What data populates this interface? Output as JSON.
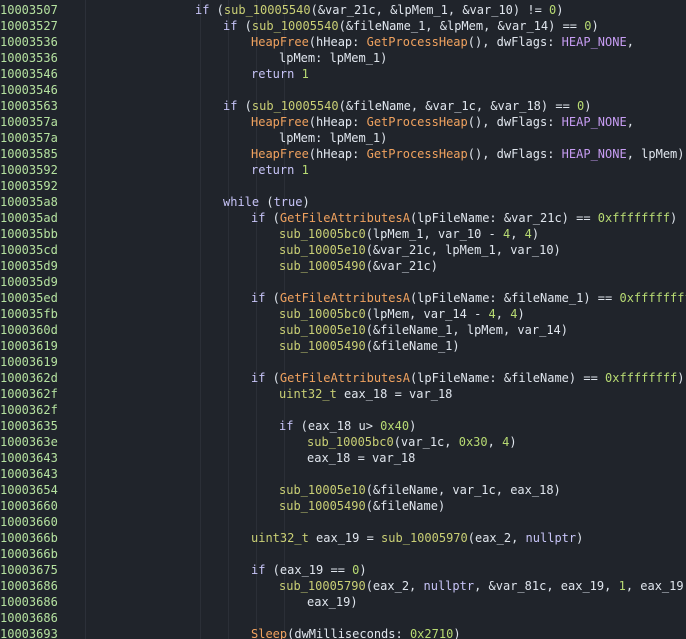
{
  "colors": {
    "background": "#20242b",
    "address": "#b5e2a0",
    "keyword": "#c7c4f7",
    "import_function": "#f0a25f",
    "symbol": "#c9cf75",
    "number": "#b8db73",
    "constant": "#c69cf2",
    "text": "#d6dde6"
  },
  "lines": [
    {
      "addr": "10003507",
      "indent": 0,
      "tokens": [
        [
          "k",
          "if"
        ],
        [
          "t",
          " ("
        ],
        [
          "s",
          "sub_10005540"
        ],
        [
          "t",
          "(&var_21c, &lpMem_1, &var_10) != "
        ],
        [
          "n",
          "0"
        ],
        [
          "t",
          ")"
        ]
      ]
    },
    {
      "addr": "10003527",
      "indent": 1,
      "tokens": [
        [
          "k",
          "if"
        ],
        [
          "t",
          " ("
        ],
        [
          "s",
          "sub_10005540"
        ],
        [
          "t",
          "(&fileName_1, &lpMem, &var_14) == "
        ],
        [
          "n",
          "0"
        ],
        [
          "t",
          ")"
        ]
      ]
    },
    {
      "addr": "10003536",
      "indent": 2,
      "tokens": [
        [
          "f",
          "HeapFree"
        ],
        [
          "t",
          "(hHeap: "
        ],
        [
          "f",
          "GetProcessHeap"
        ],
        [
          "t",
          "(), dwFlags: "
        ],
        [
          "c",
          "HEAP_NONE"
        ],
        [
          "t",
          ","
        ]
      ]
    },
    {
      "addr": "10003536",
      "indent": 3,
      "tokens": [
        [
          "t",
          "lpMem: lpMem_1)"
        ]
      ]
    },
    {
      "addr": "10003546",
      "indent": 2,
      "tokens": [
        [
          "k",
          "return"
        ],
        [
          "t",
          " "
        ],
        [
          "n",
          "1"
        ]
      ]
    },
    {
      "addr": "10003546",
      "indent": 0,
      "tokens": []
    },
    {
      "addr": "10003563",
      "indent": 1,
      "tokens": [
        [
          "k",
          "if"
        ],
        [
          "t",
          " ("
        ],
        [
          "s",
          "sub_10005540"
        ],
        [
          "t",
          "(&fileName, &var_1c, &var_18) == "
        ],
        [
          "n",
          "0"
        ],
        [
          "t",
          ")"
        ]
      ]
    },
    {
      "addr": "1000357a",
      "indent": 2,
      "tokens": [
        [
          "f",
          "HeapFree"
        ],
        [
          "t",
          "(hHeap: "
        ],
        [
          "f",
          "GetProcessHeap"
        ],
        [
          "t",
          "(), dwFlags: "
        ],
        [
          "c",
          "HEAP_NONE"
        ],
        [
          "t",
          ","
        ]
      ]
    },
    {
      "addr": "1000357a",
      "indent": 3,
      "tokens": [
        [
          "t",
          "lpMem: lpMem_1)"
        ]
      ]
    },
    {
      "addr": "10003585",
      "indent": 2,
      "tokens": [
        [
          "f",
          "HeapFree"
        ],
        [
          "t",
          "(hHeap: "
        ],
        [
          "f",
          "GetProcessHeap"
        ],
        [
          "t",
          "(), dwFlags: "
        ],
        [
          "c",
          "HEAP_NONE"
        ],
        [
          "t",
          ", lpMem)"
        ]
      ]
    },
    {
      "addr": "10003592",
      "indent": 2,
      "tokens": [
        [
          "k",
          "return"
        ],
        [
          "t",
          " "
        ],
        [
          "n",
          "1"
        ]
      ]
    },
    {
      "addr": "10003592",
      "indent": 0,
      "tokens": []
    },
    {
      "addr": "100035a8",
      "indent": 1,
      "tokens": [
        [
          "k",
          "while"
        ],
        [
          "t",
          " ("
        ],
        [
          "k",
          "true"
        ],
        [
          "t",
          ")"
        ]
      ]
    },
    {
      "addr": "100035ad",
      "indent": 2,
      "tokens": [
        [
          "k",
          "if"
        ],
        [
          "t",
          " ("
        ],
        [
          "f",
          "GetFileAttributesA"
        ],
        [
          "t",
          "(lpFileName: &var_21c) == "
        ],
        [
          "n",
          "0xffffffff"
        ],
        [
          "t",
          ")"
        ]
      ]
    },
    {
      "addr": "100035bb",
      "indent": 3,
      "tokens": [
        [
          "s",
          "sub_10005bc0"
        ],
        [
          "t",
          "(lpMem_1, var_10 - "
        ],
        [
          "n",
          "4"
        ],
        [
          "t",
          ", "
        ],
        [
          "n",
          "4"
        ],
        [
          "t",
          ")"
        ]
      ]
    },
    {
      "addr": "100035cd",
      "indent": 3,
      "tokens": [
        [
          "s",
          "sub_10005e10"
        ],
        [
          "t",
          "(&var_21c, lpMem_1, var_10)"
        ]
      ]
    },
    {
      "addr": "100035d9",
      "indent": 3,
      "tokens": [
        [
          "s",
          "sub_10005490"
        ],
        [
          "t",
          "(&var_21c)"
        ]
      ]
    },
    {
      "addr": "100035d9",
      "indent": 0,
      "tokens": []
    },
    {
      "addr": "100035ed",
      "indent": 2,
      "tokens": [
        [
          "k",
          "if"
        ],
        [
          "t",
          " ("
        ],
        [
          "f",
          "GetFileAttributesA"
        ],
        [
          "t",
          "(lpFileName: &fileName_1) == "
        ],
        [
          "n",
          "0xffffffff"
        ],
        [
          "t",
          ")"
        ]
      ]
    },
    {
      "addr": "100035fb",
      "indent": 3,
      "tokens": [
        [
          "s",
          "sub_10005bc0"
        ],
        [
          "t",
          "(lpMem, var_14 - "
        ],
        [
          "n",
          "4"
        ],
        [
          "t",
          ", "
        ],
        [
          "n",
          "4"
        ],
        [
          "t",
          ")"
        ]
      ]
    },
    {
      "addr": "1000360d",
      "indent": 3,
      "tokens": [
        [
          "s",
          "sub_10005e10"
        ],
        [
          "t",
          "(&fileName_1, lpMem, var_14)"
        ]
      ]
    },
    {
      "addr": "10003619",
      "indent": 3,
      "tokens": [
        [
          "s",
          "sub_10005490"
        ],
        [
          "t",
          "(&fileName_1)"
        ]
      ]
    },
    {
      "addr": "10003619",
      "indent": 0,
      "tokens": []
    },
    {
      "addr": "1000362d",
      "indent": 2,
      "tokens": [
        [
          "k",
          "if"
        ],
        [
          "t",
          " ("
        ],
        [
          "f",
          "GetFileAttributesA"
        ],
        [
          "t",
          "(lpFileName: &fileName) == "
        ],
        [
          "n",
          "0xffffffff"
        ],
        [
          "t",
          ")"
        ]
      ]
    },
    {
      "addr": "1000362f",
      "indent": 3,
      "tokens": [
        [
          "s",
          "uint32_t"
        ],
        [
          "t",
          " eax_18 = var_18"
        ]
      ]
    },
    {
      "addr": "1000362f",
      "indent": 0,
      "tokens": []
    },
    {
      "addr": "10003635",
      "indent": 3,
      "tokens": [
        [
          "k",
          "if"
        ],
        [
          "t",
          " (eax_18 u> "
        ],
        [
          "n",
          "0x40"
        ],
        [
          "t",
          ")"
        ]
      ]
    },
    {
      "addr": "1000363e",
      "indent": 4,
      "tokens": [
        [
          "s",
          "sub_10005bc0"
        ],
        [
          "t",
          "(var_1c, "
        ],
        [
          "n",
          "0x30"
        ],
        [
          "t",
          ", "
        ],
        [
          "n",
          "4"
        ],
        [
          "t",
          ")"
        ]
      ]
    },
    {
      "addr": "10003643",
      "indent": 4,
      "tokens": [
        [
          "t",
          "eax_18 = var_18"
        ]
      ]
    },
    {
      "addr": "10003643",
      "indent": 0,
      "tokens": []
    },
    {
      "addr": "10003654",
      "indent": 3,
      "tokens": [
        [
          "s",
          "sub_10005e10"
        ],
        [
          "t",
          "(&fileName, var_1c, eax_18)"
        ]
      ]
    },
    {
      "addr": "10003660",
      "indent": 3,
      "tokens": [
        [
          "s",
          "sub_10005490"
        ],
        [
          "t",
          "(&fileName)"
        ]
      ]
    },
    {
      "addr": "10003660",
      "indent": 0,
      "tokens": []
    },
    {
      "addr": "1000366b",
      "indent": 2,
      "tokens": [
        [
          "s",
          "uint32_t"
        ],
        [
          "t",
          " eax_19 = "
        ],
        [
          "s",
          "sub_10005970"
        ],
        [
          "t",
          "(eax_2, "
        ],
        [
          "k",
          "nullptr"
        ],
        [
          "t",
          ")"
        ]
      ]
    },
    {
      "addr": "1000366b",
      "indent": 0,
      "tokens": []
    },
    {
      "addr": "10003675",
      "indent": 2,
      "tokens": [
        [
          "k",
          "if"
        ],
        [
          "t",
          " (eax_19 == "
        ],
        [
          "n",
          "0"
        ],
        [
          "t",
          ")"
        ]
      ]
    },
    {
      "addr": "10003686",
      "indent": 3,
      "tokens": [
        [
          "s",
          "sub_10005790"
        ],
        [
          "t",
          "(eax_2, "
        ],
        [
          "k",
          "nullptr"
        ],
        [
          "t",
          ", &var_81c, eax_19, "
        ],
        [
          "n",
          "1"
        ],
        [
          "t",
          ", eax_19,"
        ]
      ]
    },
    {
      "addr": "10003686",
      "indent": 4,
      "tokens": [
        [
          "t",
          "eax_19)"
        ]
      ]
    },
    {
      "addr": "10003686",
      "indent": 0,
      "tokens": []
    },
    {
      "addr": "10003693",
      "indent": 2,
      "tokens": [
        [
          "f",
          "Sleep"
        ],
        [
          "t",
          "(dwMilliseconds: "
        ],
        [
          "n",
          "0x2710"
        ],
        [
          "t",
          ")"
        ]
      ]
    }
  ]
}
